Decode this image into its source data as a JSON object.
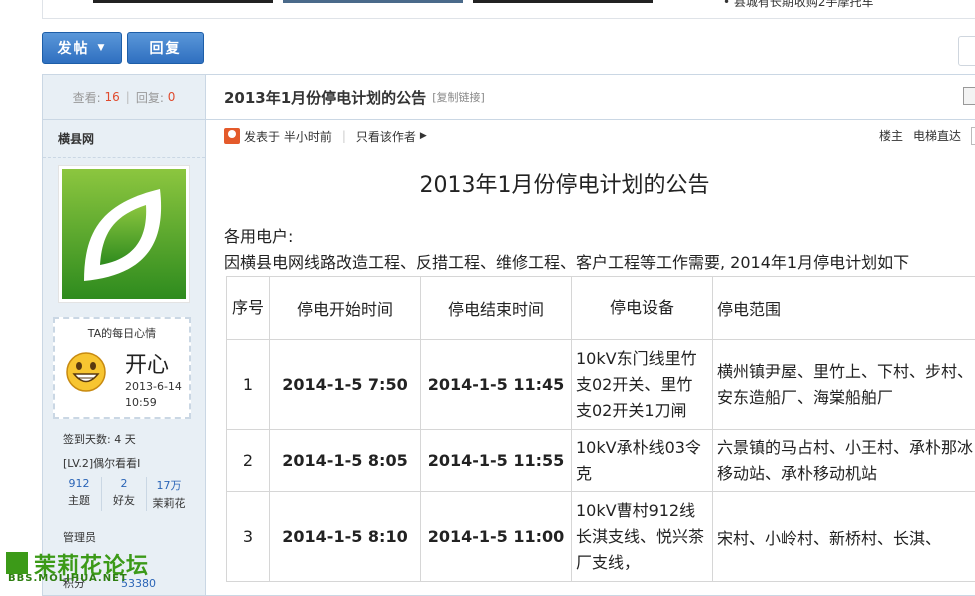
{
  "top": {
    "news_text": "• 县城有长期收购2手摩托车"
  },
  "toolbar": {
    "post_label": "发帖",
    "reply_label": "回复"
  },
  "sidebar": {
    "views_label": "查看:",
    "views": "16",
    "replies_label": "回复:",
    "replies": "0",
    "author": "横县网",
    "mood_heading": "TA的每日心情",
    "mood_word": "开心",
    "mood_date": "2013-6-14 10:59",
    "sign_days": "签到天数: 4 天",
    "level": "[LV.2]偶尔看看I",
    "counts": [
      {
        "value": "912",
        "label": "主题"
      },
      {
        "value": "2",
        "label": "好友"
      },
      {
        "value": "17万",
        "label": "茉莉花"
      }
    ],
    "role": "管理员",
    "credit_label": "积分",
    "credit_value": "53380"
  },
  "post": {
    "title": "2013年1月份停电计划的公告",
    "copy_link": "[复制链接]",
    "posted": "发表于 半小时前",
    "only_author": "只看该作者",
    "floor": "楼主",
    "jump": "电梯直达",
    "heading": "2013年1月份停电计划的公告",
    "greeting": "各用电户:",
    "intro": "因横县电网线路改造工程、反措工程、维修工程、客户工程等工作需要, 2014年1月停电计划如下"
  },
  "table": {
    "headers": [
      "序号",
      "停电开始时间",
      "停电结束时间",
      "停电设备",
      "停电范围"
    ],
    "rows": [
      {
        "no": "1",
        "start": "2014-1-5 7:50",
        "end": "2014-1-5 11:45",
        "device": "10kV东门线里竹支02开关、里竹支02开关1刀闸",
        "range": "横州镇尹屋、里竹上、下村、步村、安东造船厂、海棠船舶厂"
      },
      {
        "no": "2",
        "start": "2014-1-5 8:05",
        "end": "2014-1-5 11:55",
        "device": "10kV承朴线03令克",
        "range": "六景镇的马占村、小王村、承朴那冰移动站、承朴移动机站"
      },
      {
        "no": "3",
        "start": "2014-1-5 8:10",
        "end": "2014-1-5 11:00",
        "device": "10kV曹村912线长淇支线、悦兴茶厂支线，",
        "range": "宋村、小岭村、新桥村、长淇、"
      }
    ]
  },
  "footer": {
    "logo_big": "茉莉花论坛",
    "logo_small": "BBS.MOLIHUA.NET"
  },
  "colors": {
    "accent_blue": "#2f6fc0",
    "stat_red": "#e04b2e",
    "logo_green": "#3c9a18"
  }
}
